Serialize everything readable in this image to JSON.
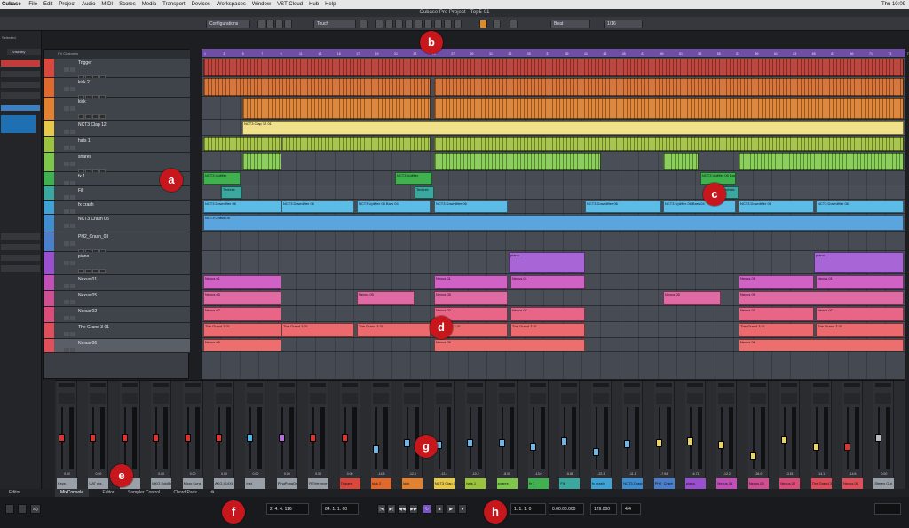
{
  "menubar": {
    "app": "Cubase",
    "items": [
      "File",
      "Edit",
      "Project",
      "Audio",
      "MIDI",
      "Scores",
      "Media",
      "Transport",
      "Devices",
      "Workspaces",
      "Window",
      "VST Cloud",
      "Hub",
      "Help"
    ],
    "clock": "Thu 10:09"
  },
  "window": {
    "title": "Cubase Pro Project - Top5-01"
  },
  "toolbar": {
    "configurations": "Configurations",
    "automation_mode": "Touch",
    "grid_type": "Beat",
    "quantize": "1/16"
  },
  "inspector": {
    "selected_label": "Selected",
    "tab_visibility": "Visibility",
    "items": [
      "",
      "",
      "",
      "",
      "",
      "",
      "",
      ""
    ]
  },
  "tracklist": {
    "header": "FX Channels",
    "tracks": [
      {
        "name": "Trigger",
        "color": "#d9473d"
      },
      {
        "name": "kick 2",
        "color": "#e06a2d"
      },
      {
        "name": "kick",
        "color": "#e2812f"
      },
      {
        "name": "NCT3 Clap 12",
        "color": "#e7c94a"
      },
      {
        "name": "hats 1",
        "color": "#9bc23c"
      },
      {
        "name": "snares",
        "color": "#7fc74a"
      },
      {
        "name": "fx 1",
        "color": "#3fb14f"
      },
      {
        "name": "Fill",
        "color": "#3aa89e"
      },
      {
        "name": "fx crash",
        "color": "#3fa3d6"
      },
      {
        "name": "NCT3 Crash 05",
        "color": "#3e8ed1"
      },
      {
        "name": "PH2_Crash_03",
        "color": "#4b7fcc"
      },
      {
        "name": "piano",
        "color": "#9a4fcf"
      },
      {
        "name": "Nexus 01",
        "color": "#c24fb7"
      },
      {
        "name": "Nexus 05",
        "color": "#d04f92"
      },
      {
        "name": "Nexus 02",
        "color": "#dc4c7a"
      },
      {
        "name": "The Grand 3 01",
        "color": "#e04e5c"
      },
      {
        "name": "Nexus 06",
        "color": "#e0505a"
      }
    ]
  },
  "ruler": {
    "bars": [
      "1",
      "3",
      "5",
      "7",
      "9",
      "11",
      "13",
      "15",
      "17",
      "19",
      "21",
      "23",
      "25",
      "27",
      "29",
      "31",
      "33",
      "35",
      "37",
      "39",
      "41",
      "43",
      "45",
      "47",
      "49",
      "51",
      "53",
      "55",
      "57",
      "59",
      "61",
      "63",
      "65",
      "67",
      "69",
      "71",
      "73",
      "75"
    ]
  },
  "clips": {
    "nct3_clap": "NCT3 Clap 12 01",
    "fx1": "NCT3 Uplifter",
    "fill": "Technix",
    "fx_crash": "NCT3 Downlifter 06",
    "crash05": "NCT3 Crash 05",
    "piano": "piano",
    "nexus01": "Nexus 01",
    "nexus05": "Nexus 05",
    "nexus02": "Nexus 02",
    "grand": "The Grand 3 01",
    "nexus06": "Nexus 06",
    "uplifter_bars": "NCT3 Uplifter 06 Bars 04"
  },
  "mixer": {
    "channels": [
      {
        "name": "Keys",
        "color": "#9aa0a8",
        "vol": "0.00",
        "cap": "#d33",
        "level": 0.55
      },
      {
        "name": "UAT ms",
        "color": "#9aa0a8",
        "vol": "0.00",
        "cap": "#d33",
        "level": 0.55
      },
      {
        "name": "",
        "color": "#9aa0a8",
        "vol": "0.00",
        "cap": "#d33",
        "level": 0.55
      },
      {
        "name": "MKG SubBlube",
        "color": "#9aa0a8",
        "vol": "0.00",
        "cap": "#d33",
        "level": 0.55
      },
      {
        "name": "Micro Korg",
        "color": "#9aa0a8",
        "vol": "0.00",
        "cap": "#d33",
        "level": 0.55
      },
      {
        "name": "AKG 414XL S",
        "color": "#9aa0a8",
        "vol": "0.00",
        "cap": "#d33",
        "level": 0.55
      },
      {
        "name": "Inst",
        "color": "#9aa0a8",
        "vol": "0.00",
        "cap": "#4ab8e8",
        "level": 0.55
      },
      {
        "name": "PingPongDelay",
        "color": "#9aa0a8",
        "vol": "0.00",
        "cap": "#b86fd8",
        "level": 0.55
      },
      {
        "name": "REVerence",
        "color": "#9aa0a8",
        "vol": "0.00",
        "cap": "#d33",
        "level": 0.55
      },
      {
        "name": "Trigger",
        "color": "#d9473d",
        "vol": "0.00",
        "cap": "#d33",
        "level": 0.55
      },
      {
        "name": "kick 2",
        "color": "#e06a2d",
        "vol": "-14.5",
        "cap": "#6fb6e6",
        "level": 0.35
      },
      {
        "name": "kick",
        "color": "#e2812f",
        "vol": "-12.0",
        "cap": "#6fb6e6",
        "level": 0.45
      },
      {
        "name": "NCT3 Clap 12",
        "color": "#e7c94a",
        "vol": "-12.4",
        "cap": "#6fb6e6",
        "level": 0.42
      },
      {
        "name": "hats 1",
        "color": "#9bc23c",
        "vol": "-10.2",
        "cap": "#6fb6e6",
        "level": 0.45
      },
      {
        "name": "snares",
        "color": "#7fc74a",
        "vol": "-8.05",
        "cap": "#6fb6e6",
        "level": 0.45
      },
      {
        "name": "fx 1",
        "color": "#3fb14f",
        "vol": "-13.0",
        "cap": "#6fb6e6",
        "level": 0.4
      },
      {
        "name": "Fill",
        "color": "#3aa89e",
        "vol": "-5.86",
        "cap": "#6fb6e6",
        "level": 0.48
      },
      {
        "name": "fx crash",
        "color": "#3fa3d6",
        "vol": "-22.3",
        "cap": "#6fb6e6",
        "level": 0.3
      },
      {
        "name": "NCT3 Crash 05",
        "color": "#3e8ed1",
        "vol": "-11.1",
        "cap": "#6fb6e6",
        "level": 0.44
      },
      {
        "name": "PH2_Crash_03",
        "color": "#4b7fcc",
        "vol": "-7.94",
        "cap": "#e8d36a",
        "level": 0.46
      },
      {
        "name": "piano",
        "color": "#9a4fcf",
        "vol": "-6.71",
        "cap": "#e8d36a",
        "level": 0.48
      },
      {
        "name": "Nexus 01",
        "color": "#c24fb7",
        "vol": "-12.2",
        "cap": "#e8d36a",
        "level": 0.42
      },
      {
        "name": "Nexus 05",
        "color": "#d04f92",
        "vol": "-26.0",
        "cap": "#e8d36a",
        "level": 0.25
      },
      {
        "name": "Nexus 02",
        "color": "#dc4c7a",
        "vol": "-3.51",
        "cap": "#e8d36a",
        "level": 0.52
      },
      {
        "name": "The Grand 3 01",
        "color": "#e04e5c",
        "vol": "-14.1",
        "cap": "#e8d36a",
        "level": 0.4
      },
      {
        "name": "Nexus 06",
        "color": "#e0505a",
        "vol": "-14.6",
        "cap": "#d33",
        "level": 0.4
      },
      {
        "name": "Stereo Out",
        "color": "#9aa0a8",
        "vol": "0.00",
        "cap": "#bbb",
        "level": 0.55
      }
    ]
  },
  "bottom_tabs": {
    "left": "Editor",
    "mixconsole": "MixConsole",
    "editor": "Editor",
    "sampler": "Sampler Control",
    "chordpads": "Chord Pads"
  },
  "transport": {
    "left_locator": "2. 4. 4. 116",
    "right_locator": "84. 1. 1. 60",
    "position": "1. 1. 1. 0",
    "time": "0:00:00.000",
    "tempo": "129.000",
    "signature": "4/4"
  },
  "badges": {
    "a": "a",
    "b": "b",
    "c": "c",
    "d": "d",
    "e": "e",
    "f": "f",
    "g": "g",
    "h": "h"
  }
}
